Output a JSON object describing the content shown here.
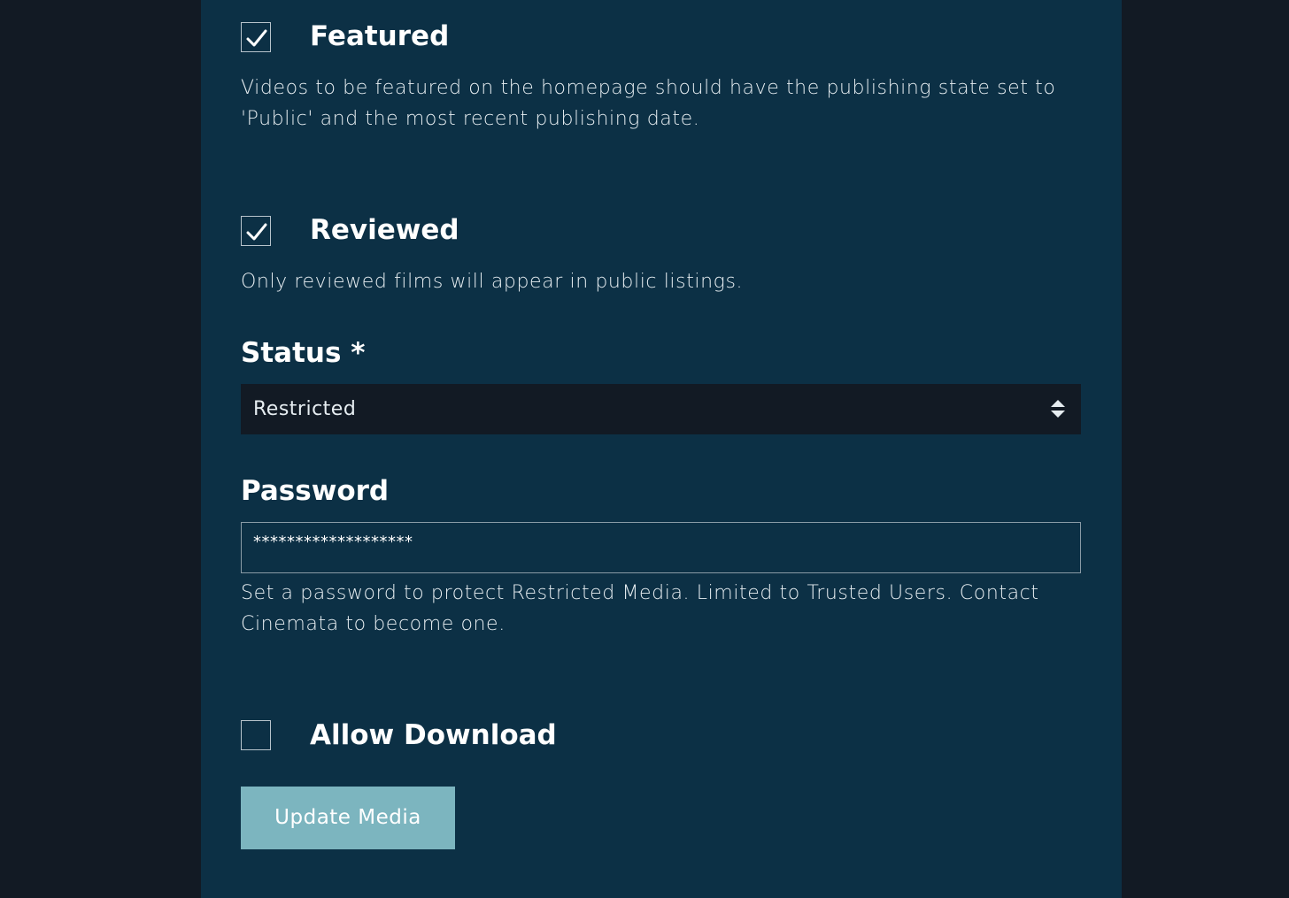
{
  "featured": {
    "label": "Featured",
    "checked": true,
    "help": "Videos to be featured on the homepage should have the publishing state set to 'Public' and the most recent publishing date."
  },
  "reviewed": {
    "label": "Reviewed",
    "checked": true,
    "help": "Only reviewed films will appear in public listings."
  },
  "status": {
    "label": "Status *",
    "value": "Restricted"
  },
  "password": {
    "label": "Password",
    "value": "*******************",
    "help": "Set a password to protect Restricted Media. Limited to Trusted Users. Contact Cinemata to become one."
  },
  "allow_download": {
    "label": "Allow Download",
    "checked": false
  },
  "submit": {
    "label": "Update Media"
  },
  "colors": {
    "page_background": "#121a24",
    "panel_background": "#0c3045",
    "select_background": "#121a24",
    "button_background": "#7cb5bf",
    "text": "#ffffff"
  },
  "icons": {
    "checkmark": "checkmark-icon",
    "select_arrows": "sort-arrows-icon"
  }
}
